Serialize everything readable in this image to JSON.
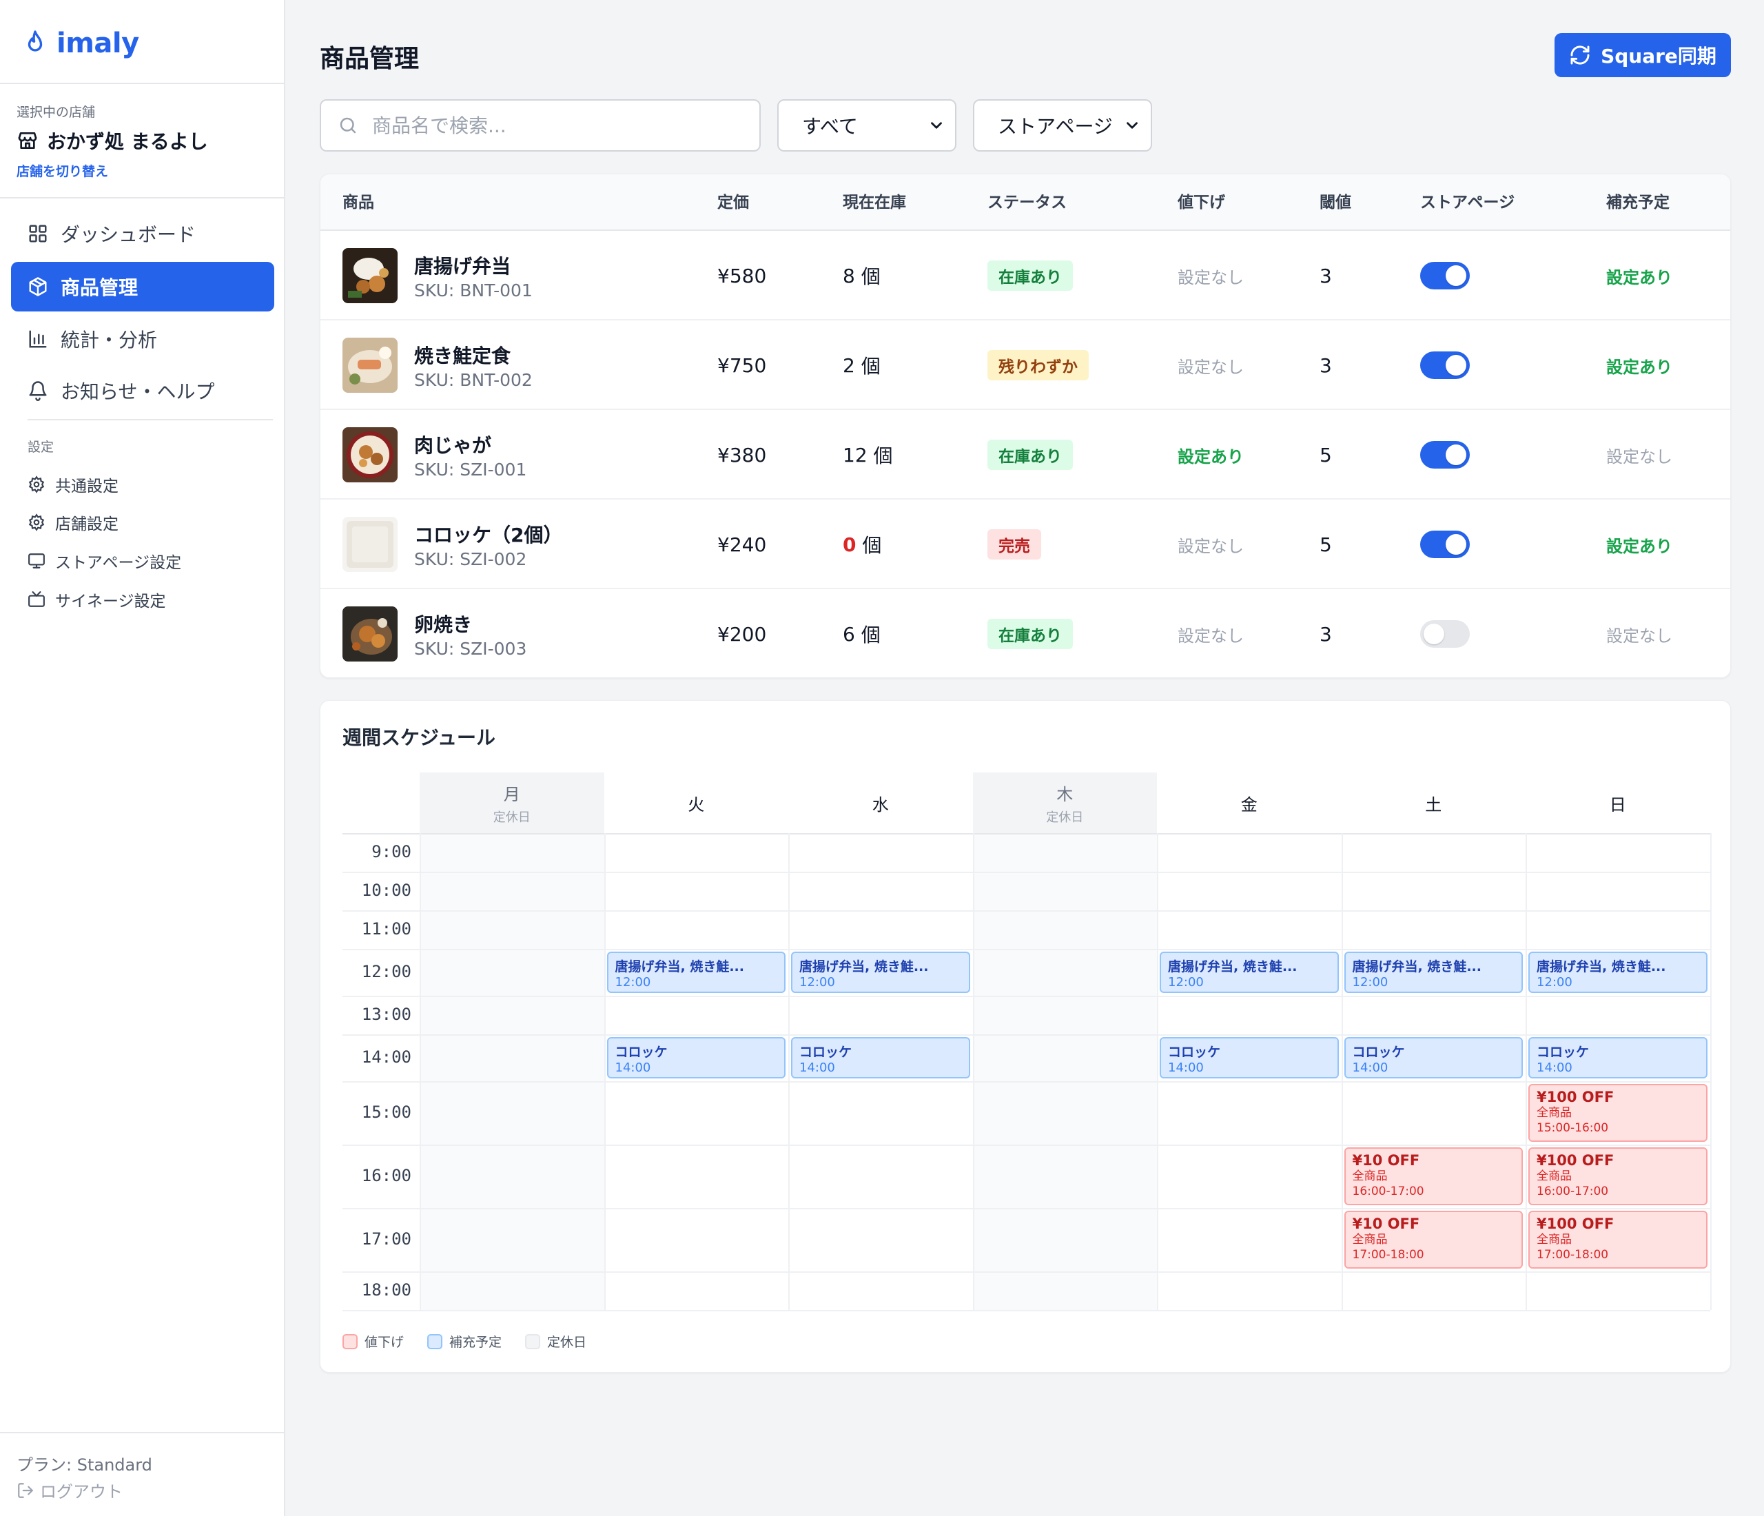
{
  "app": {
    "name": "imaly"
  },
  "store": {
    "label": "選択中の店舗",
    "name": "おかず処 まるよし",
    "switch_label": "店舗を切り替え"
  },
  "nav": [
    {
      "label": "ダッシュボード",
      "icon": "grid-icon"
    },
    {
      "label": "商品管理",
      "icon": "box-icon",
      "active": true
    },
    {
      "label": "統計・分析",
      "icon": "bar-chart-icon"
    },
    {
      "label": "お知らせ・ヘルプ",
      "icon": "bell-icon"
    }
  ],
  "settings": {
    "label": "設定",
    "items": [
      {
        "label": "共通設定",
        "icon": "gear-icon"
      },
      {
        "label": "店舗設定",
        "icon": "gear-icon"
      },
      {
        "label": "ストアページ設定",
        "icon": "monitor-icon"
      },
      {
        "label": "サイネージ設定",
        "icon": "tv-icon"
      }
    ]
  },
  "footer": {
    "plan": "プラン: Standard",
    "logout": "ログアウト"
  },
  "page": {
    "title": "商品管理",
    "sync_button": "Square同期"
  },
  "filters": {
    "search_placeholder": "商品名で検索...",
    "category": "すべて",
    "view": "ストアページ"
  },
  "table": {
    "headers": [
      "商品",
      "定価",
      "現在在庫",
      "ステータス",
      "値下げ",
      "閾値",
      "ストアページ",
      "補充予定"
    ],
    "rows": [
      {
        "name": "唐揚げ弁当",
        "sku": "SKU: BNT-001",
        "price": "¥580",
        "stock": "8",
        "unit": "個",
        "status": "在庫あり",
        "status_type": "green",
        "discount": "設定なし",
        "threshold": "3",
        "storepage": true,
        "restock": "設定あり"
      },
      {
        "name": "焼き鮭定食",
        "sku": "SKU: BNT-002",
        "price": "¥750",
        "stock": "2",
        "unit": "個",
        "status": "残りわずか",
        "status_type": "yellow",
        "discount": "設定なし",
        "threshold": "3",
        "storepage": true,
        "restock": "設定あり"
      },
      {
        "name": "肉じゃが",
        "sku": "SKU: SZI-001",
        "price": "¥380",
        "stock": "12",
        "unit": "個",
        "status": "在庫あり",
        "status_type": "green",
        "discount": "設定あり",
        "threshold": "5",
        "storepage": true,
        "restock": "設定なし"
      },
      {
        "name": "コロッケ（2個）",
        "sku": "SKU: SZI-002",
        "price": "¥240",
        "stock": "0",
        "unit": "個",
        "status": "完売",
        "status_type": "red",
        "discount": "設定なし",
        "threshold": "5",
        "storepage": true,
        "restock": "設定あり"
      },
      {
        "name": "卵焼き",
        "sku": "SKU: SZI-003",
        "price": "¥200",
        "stock": "6",
        "unit": "個",
        "status": "在庫あり",
        "status_type": "green",
        "discount": "設定なし",
        "threshold": "3",
        "storepage": false,
        "restock": "設定なし"
      }
    ]
  },
  "schedule": {
    "title": "週間スケジュール",
    "days": [
      {
        "label": "月",
        "closed": true,
        "sub": "定休日"
      },
      {
        "label": "火",
        "closed": false
      },
      {
        "label": "水",
        "closed": false
      },
      {
        "label": "木",
        "closed": true,
        "sub": "定休日"
      },
      {
        "label": "金",
        "closed": false
      },
      {
        "label": "土",
        "closed": false
      },
      {
        "label": "日",
        "closed": false
      }
    ],
    "times": [
      "9:00",
      "10:00",
      "11:00",
      "12:00",
      "13:00",
      "14:00",
      "15:00",
      "16:00",
      "17:00",
      "18:00"
    ],
    "events": [
      {
        "day": 1,
        "slot": 3,
        "type": "restock",
        "title": "唐揚げ弁当, 焼き鮭...",
        "time": "12:00"
      },
      {
        "day": 2,
        "slot": 3,
        "type": "restock",
        "title": "唐揚げ弁当, 焼き鮭...",
        "time": "12:00"
      },
      {
        "day": 4,
        "slot": 3,
        "type": "restock",
        "title": "唐揚げ弁当, 焼き鮭...",
        "time": "12:00"
      },
      {
        "day": 5,
        "slot": 3,
        "type": "restock",
        "title": "唐揚げ弁当, 焼き鮭...",
        "time": "12:00"
      },
      {
        "day": 6,
        "slot": 3,
        "type": "restock",
        "title": "唐揚げ弁当, 焼き鮭...",
        "time": "12:00"
      },
      {
        "day": 1,
        "slot": 5,
        "type": "restock",
        "title": "コロッケ",
        "time": "14:00"
      },
      {
        "day": 2,
        "slot": 5,
        "type": "restock",
        "title": "コロッケ",
        "time": "14:00"
      },
      {
        "day": 4,
        "slot": 5,
        "type": "restock",
        "title": "コロッケ",
        "time": "14:00"
      },
      {
        "day": 5,
        "slot": 5,
        "type": "restock",
        "title": "コロッケ",
        "time": "14:00"
      },
      {
        "day": 6,
        "slot": 5,
        "type": "restock",
        "title": "コロッケ",
        "time": "14:00"
      },
      {
        "day": 6,
        "slot": 6,
        "type": "discount",
        "title": "¥100 OFF",
        "target": "全商品",
        "time": "15:00-16:00"
      },
      {
        "day": 5,
        "slot": 7,
        "type": "discount",
        "title": "¥10 OFF",
        "target": "全商品",
        "time": "16:00-17:00"
      },
      {
        "day": 6,
        "slot": 7,
        "type": "discount",
        "title": "¥100 OFF",
        "target": "全商品",
        "time": "16:00-17:00"
      },
      {
        "day": 5,
        "slot": 8,
        "type": "discount",
        "title": "¥10 OFF",
        "target": "全商品",
        "time": "17:00-18:00"
      },
      {
        "day": 6,
        "slot": 8,
        "type": "discount",
        "title": "¥100 OFF",
        "target": "全商品",
        "time": "17:00-18:00"
      }
    ],
    "legend": [
      {
        "label": "値下げ",
        "color": "#fee2e2"
      },
      {
        "label": "補充予定",
        "color": "#dbeafe"
      },
      {
        "label": "定休日",
        "color": "#f3f4f6"
      }
    ]
  }
}
